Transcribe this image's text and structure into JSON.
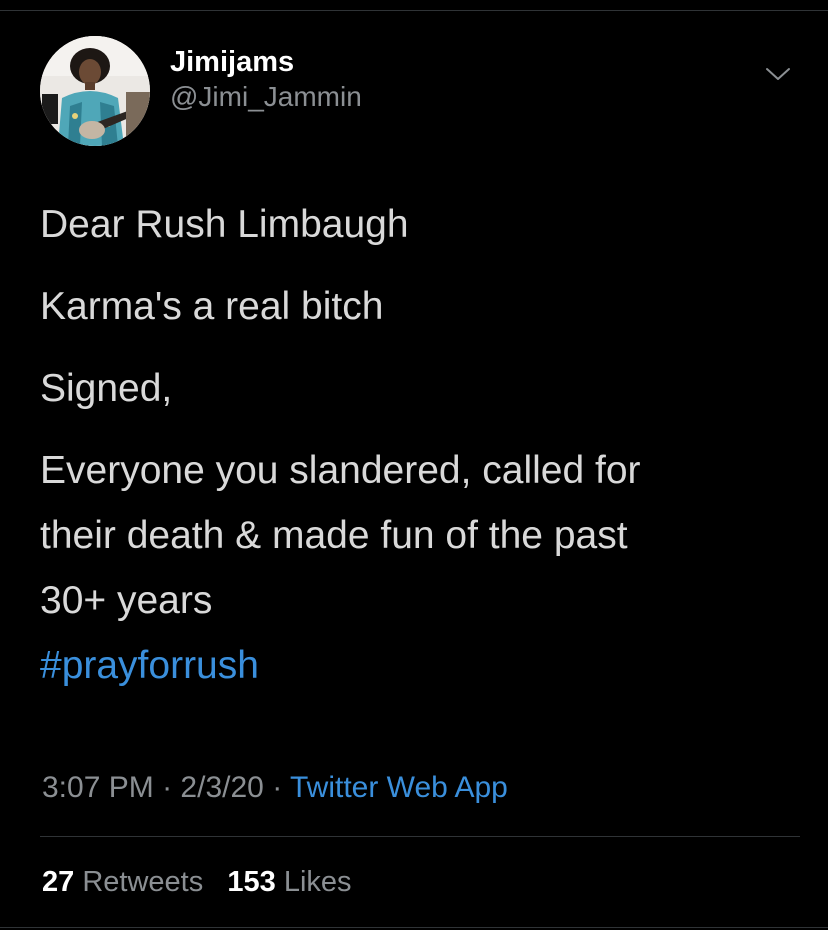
{
  "author": {
    "display_name": "Jimijams",
    "handle": "@Jimi_Jammin"
  },
  "tweet": {
    "line1": "Dear Rush Limbaugh",
    "line2": "Karma's a real bitch",
    "line3": "Signed,",
    "line4a": "Everyone you slandered, called for",
    "line4b": "their death & made fun of the past",
    "line4c": "30+ years",
    "hashtag": "#prayforrush"
  },
  "meta": {
    "time": "3:07 PM",
    "separator": "·",
    "date": "2/3/20",
    "source": "Twitter Web App"
  },
  "stats": {
    "retweets_count": "27",
    "retweets_label": "Retweets",
    "likes_count": "153",
    "likes_label": "Likes"
  },
  "icons": {
    "more": "chevron-down-icon",
    "avatar": "avatar"
  },
  "colors": {
    "background": "#000000",
    "text": "#d9d9d9",
    "secondary": "#8b8f93",
    "link": "#3a8fdc",
    "divider": "#2f3336"
  }
}
